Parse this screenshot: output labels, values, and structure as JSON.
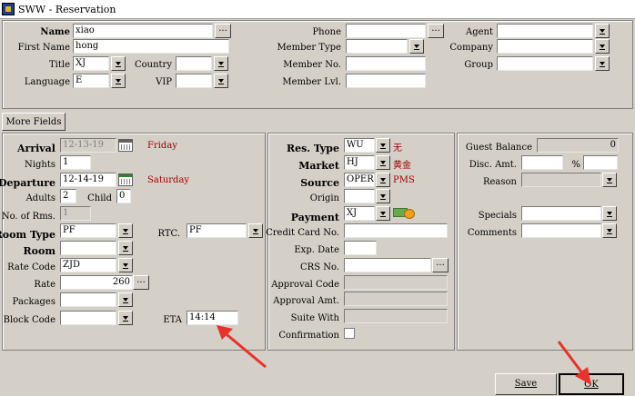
{
  "window": {
    "title": "SWW - Reservation"
  },
  "top": {
    "name_label": "Name",
    "name_value": "xiao",
    "first_name_label": "First Name",
    "first_name_value": "hong",
    "title_label": "Title",
    "title_value": "XJ",
    "country_label": "Country",
    "country_value": "",
    "language_label": "Language",
    "language_value": "E",
    "vip_label": "VIP",
    "vip_value": "",
    "phone_label": "Phone",
    "phone_value": "",
    "member_type_label": "Member Type",
    "member_type_value": "",
    "member_no_label": "Member No.",
    "member_no_value": "",
    "member_lvl_label": "Member Lvl.",
    "member_lvl_value": "",
    "agent_label": "Agent",
    "agent_value": "",
    "company_label": "Company",
    "company_value": "",
    "group_label": "Group",
    "group_value": ""
  },
  "more_fields_label": "More Fields",
  "left": {
    "arrival_label": "Arrival",
    "arrival_value": "12-13-19",
    "arrival_day": "Friday",
    "nights_label": "Nights",
    "nights_value": "1",
    "departure_label": "Departure",
    "departure_value": "12-14-19",
    "departure_day": "Saturday",
    "adults_label": "Adults",
    "adults_value": "2",
    "child_label": "Child",
    "child_value": "0",
    "rooms_label": "No. of Rms.",
    "rooms_value": "1",
    "room_type_label": "Room Type",
    "room_type_value": "PF",
    "rtc_label": "RTC.",
    "rtc_value": "PF",
    "room_label": "Room",
    "room_value": "",
    "rate_code_label": "Rate Code",
    "rate_code_value": "ZJD",
    "rate_label": "Rate",
    "rate_value": "260",
    "packages_label": "Packages",
    "packages_value": "",
    "block_code_label": "Block Code",
    "block_code_value": "",
    "eta_label": "ETA",
    "eta_value": "14:14"
  },
  "middle": {
    "res_type_label": "Res. Type",
    "res_type_value": "WU",
    "res_type_desc": "无",
    "market_label": "Market",
    "market_value": "HJ",
    "market_desc": "黄金",
    "source_label": "Source",
    "source_value": "OPERA",
    "source_desc": "PMS",
    "origin_label": "Origin",
    "origin_value": "",
    "payment_label": "Payment",
    "payment_value": "XJ",
    "credit_card_label": "Credit Card No.",
    "credit_card_value": "",
    "exp_date_label": "Exp. Date",
    "exp_date_value": "",
    "crs_no_label": "CRS No.",
    "crs_no_value": "",
    "approval_code_label": "Approval Code",
    "approval_code_value": "",
    "approval_amt_label": "Approval Amt.",
    "approval_amt_value": "",
    "suite_with_label": "Suite With",
    "suite_with_value": "",
    "confirmation_label": "Confirmation"
  },
  "right": {
    "guest_balance_label": "Guest Balance",
    "guest_balance_value": "0",
    "disc_amt_label": "Disc. Amt.",
    "disc_amt_value": "",
    "percent_label": "%",
    "percent_value": "",
    "reason_label": "Reason",
    "reason_value": "",
    "specials_label": "Specials",
    "specials_value": "",
    "comments_label": "Comments",
    "comments_value": ""
  },
  "buttons": {
    "save_label": "Save",
    "ok_label": "OK"
  },
  "colors": {
    "annotation_arrow": "#e8322a",
    "description_text": "#a00000"
  }
}
